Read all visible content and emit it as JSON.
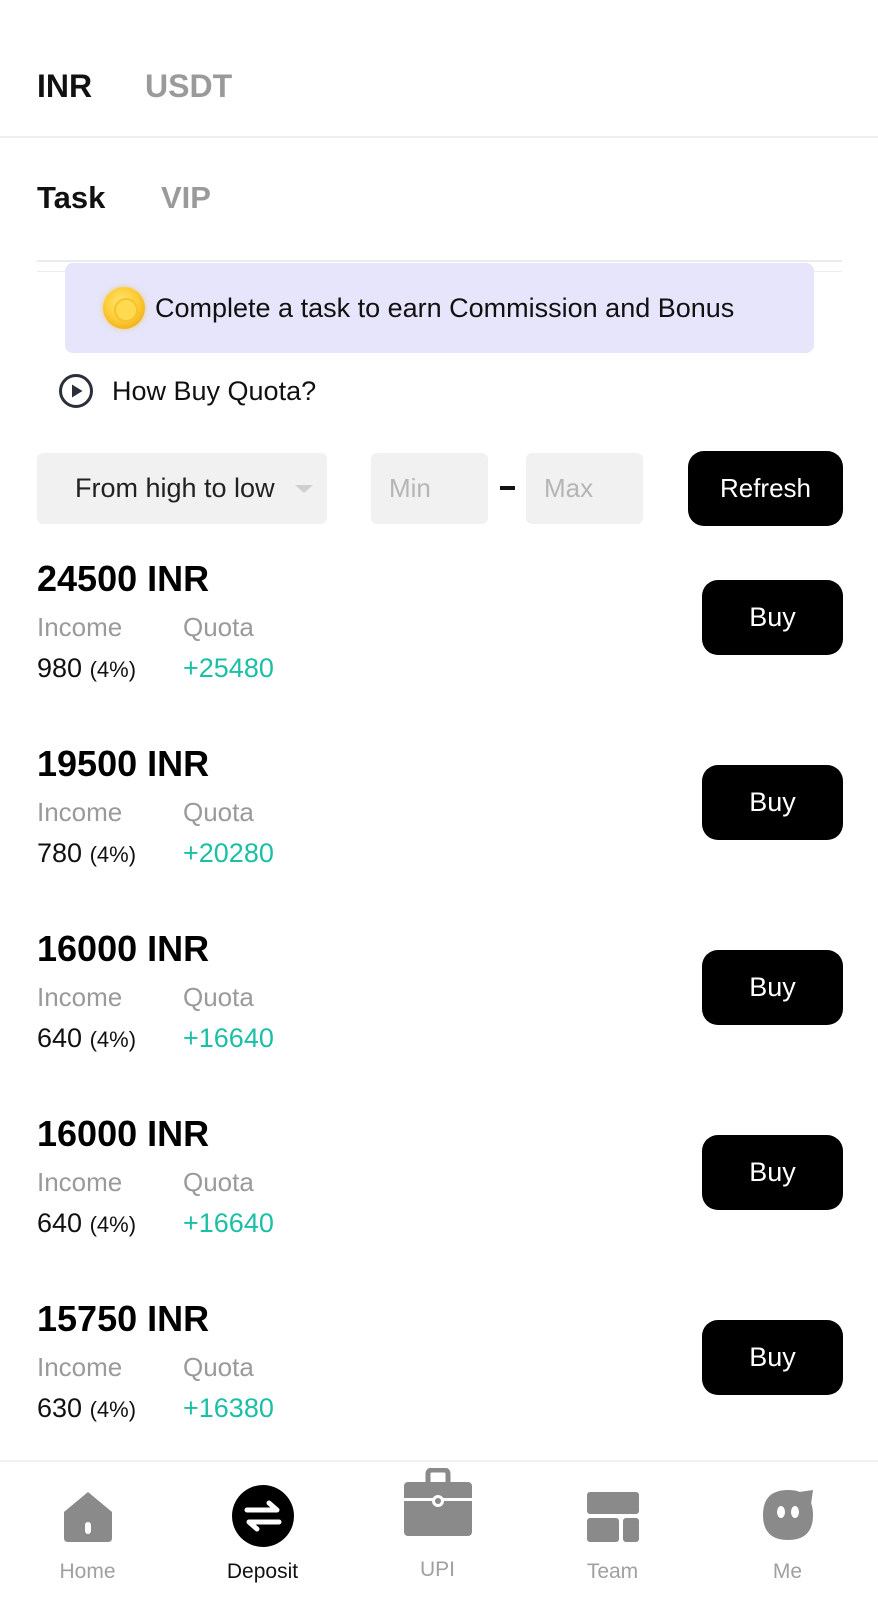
{
  "currency_tabs": {
    "active": "INR",
    "inactive": "USDT"
  },
  "type_tabs": {
    "active": "Task",
    "inactive": "VIP"
  },
  "banner": {
    "text": "Complete a task to earn Commission and Bonus",
    "icon": "coin-icon"
  },
  "howto": {
    "text": "How Buy Quota?",
    "icon": "play-circle-icon"
  },
  "filters": {
    "sort_value": "From high to low",
    "min_placeholder": "Min",
    "max_placeholder": "Max",
    "refresh_label": "Refresh"
  },
  "tasks": [
    {
      "amount": "24500 INR",
      "income_label": "Income",
      "quota_label": "Quota",
      "income": "980",
      "pct": "(4%)",
      "quota": "+25480",
      "buy_label": "Buy"
    },
    {
      "amount": "19500 INR",
      "income_label": "Income",
      "quota_label": "Quota",
      "income": "780",
      "pct": "(4%)",
      "quota": "+20280",
      "buy_label": "Buy"
    },
    {
      "amount": "16000 INR",
      "income_label": "Income",
      "quota_label": "Quota",
      "income": "640",
      "pct": "(4%)",
      "quota": "+16640",
      "buy_label": "Buy"
    },
    {
      "amount": "16000 INR",
      "income_label": "Income",
      "quota_label": "Quota",
      "income": "640",
      "pct": "(4%)",
      "quota": "+16640",
      "buy_label": "Buy"
    },
    {
      "amount": "15750 INR",
      "income_label": "Income",
      "quota_label": "Quota",
      "income": "630",
      "pct": "(4%)",
      "quota": "+16380",
      "buy_label": "Buy"
    }
  ],
  "nav": {
    "items": [
      {
        "label": "Home",
        "icon": "home-icon"
      },
      {
        "label": "Deposit",
        "icon": "exchange-icon",
        "active": true
      },
      {
        "label": "UPI",
        "icon": "briefcase-icon"
      },
      {
        "label": "Team",
        "icon": "team-grid-icon"
      },
      {
        "label": "Me",
        "icon": "face-icon"
      }
    ]
  },
  "colors": {
    "accent_green": "#1bbfa6",
    "banner_bg": "#e6e5fb",
    "button_bg": "#000000"
  }
}
